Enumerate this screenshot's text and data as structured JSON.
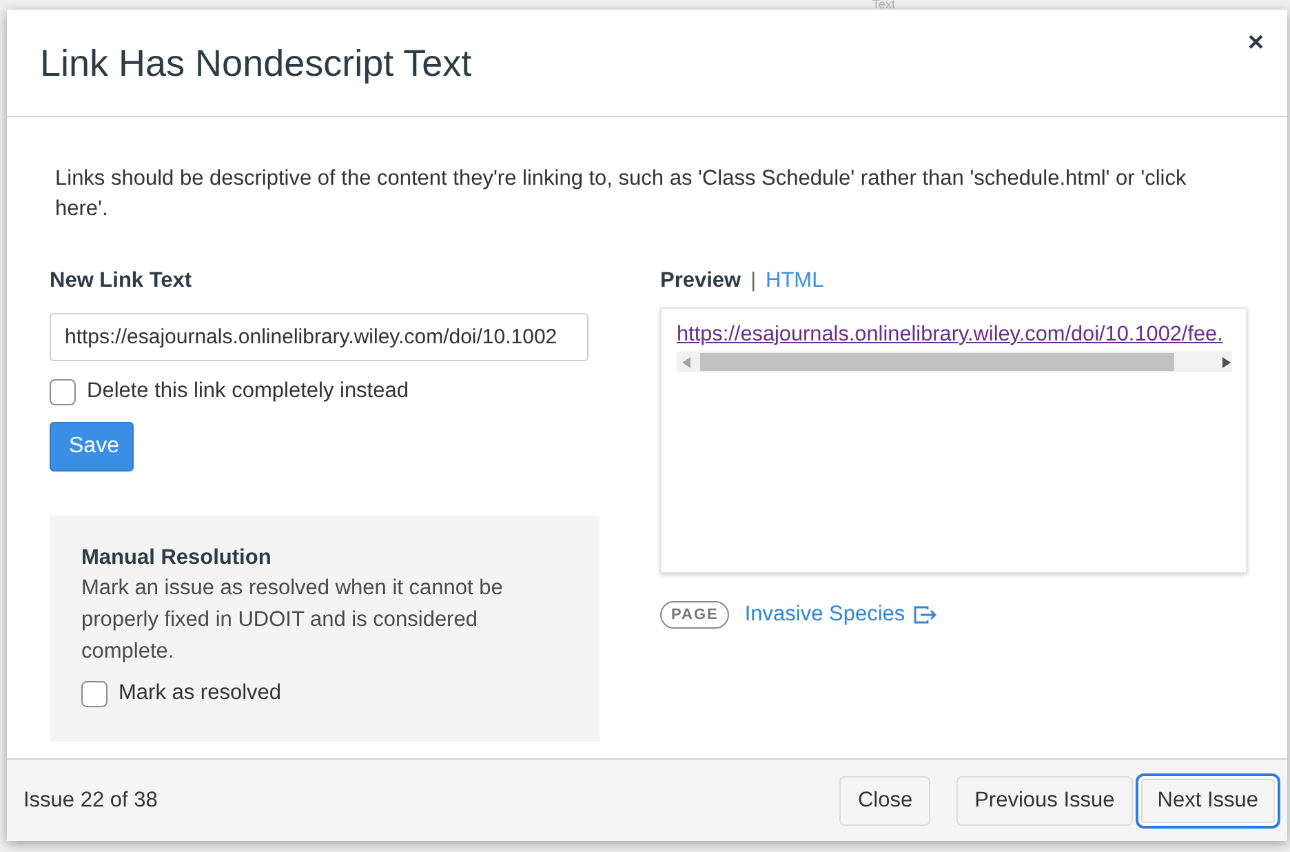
{
  "backdrop": {
    "text": "Text"
  },
  "dialog": {
    "title": "Link Has Nondescript Text",
    "close_label": "×"
  },
  "description": "Links should be descriptive of the content they're linking to, such as 'Class Schedule' rather than 'schedule.html' or 'click here'.",
  "form": {
    "label": "New Link Text",
    "input_value": "https://esajournals.onlinelibrary.wiley.com/doi/10.1002",
    "delete_checkbox": {
      "label": "Delete this link completely instead",
      "checked": false
    },
    "save_button": "Save"
  },
  "manual_resolution": {
    "title": "Manual Resolution",
    "text": "Mark an issue as resolved when it cannot be properly fixed in UDOIT and is considered complete.",
    "checkbox": {
      "label": "Mark as resolved",
      "checked": false
    }
  },
  "preview": {
    "tabs": [
      {
        "label": "Preview",
        "selected": true
      },
      {
        "label": "HTML",
        "selected": false
      }
    ],
    "separator": "|",
    "link": "https://esajournals.onlinelibrary.wiley.com/doi/10.1002/fee."
  },
  "source": {
    "badge": "PAGE",
    "link": "Invasive Species"
  },
  "footer": {
    "status": "Issue 22 of 38",
    "buttons": [
      {
        "label": "Close",
        "focused": false
      },
      {
        "label": "Previous Issue",
        "focused": false
      },
      {
        "label": "Next Issue",
        "focused": true
      }
    ]
  }
}
